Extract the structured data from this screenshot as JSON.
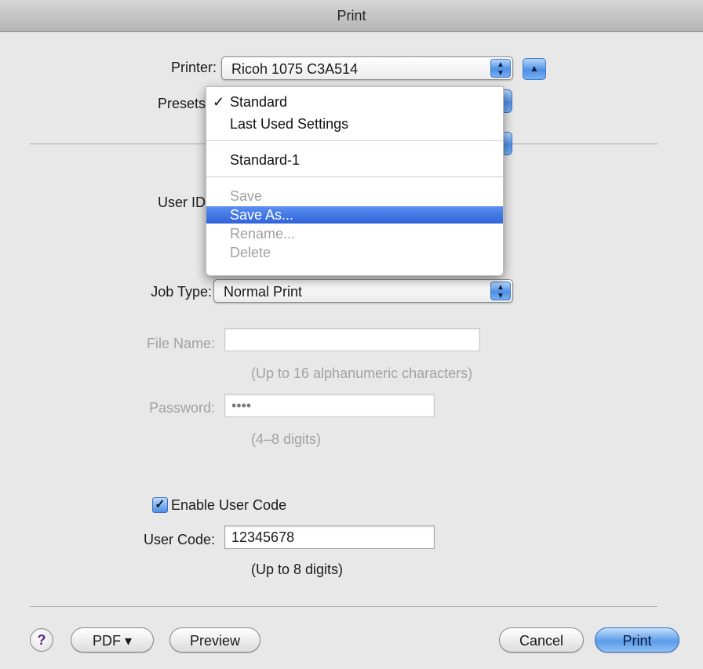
{
  "window": {
    "title": "Print"
  },
  "printer": {
    "label": "Printer:",
    "value": "Ricoh 1075 C3A514"
  },
  "presets": {
    "label": "Presets",
    "menu": {
      "checkmark": "✓",
      "items": [
        {
          "label": "Standard",
          "checked": true
        },
        {
          "label": "Last Used Settings"
        },
        {
          "label": "Standard-1"
        },
        {
          "label": "Save",
          "disabled": true
        },
        {
          "label": "Save As...",
          "highlighted": true
        },
        {
          "label": "Rename...",
          "disabled": true
        },
        {
          "label": "Delete",
          "disabled": true
        }
      ]
    }
  },
  "user_id": {
    "label": "User ID"
  },
  "job_type": {
    "label": "Job Type:",
    "value": "Normal Print"
  },
  "file_name": {
    "label": "File Name:",
    "value": "",
    "hint": "(Up to 16 alphanumeric characters)"
  },
  "password": {
    "label": "Password:",
    "value": "••••",
    "hint": "(4–8 digits)"
  },
  "enable_user_code": {
    "label": "Enable User Code",
    "checked": true,
    "check_glyph": "✓"
  },
  "user_code": {
    "label": "User Code:",
    "value": "12345678",
    "hint": "(Up to 8 digits)"
  },
  "buttons": {
    "help": "?",
    "pdf": "PDF ▾",
    "preview": "Preview",
    "cancel": "Cancel",
    "print": "Print"
  },
  "icons": {
    "popup_arrows": "▲▼",
    "disclosure": "▲"
  },
  "colors": {
    "accent": "#3f78c9",
    "menu_highlight": "#2f63d9",
    "background": "#e8e8e8"
  }
}
